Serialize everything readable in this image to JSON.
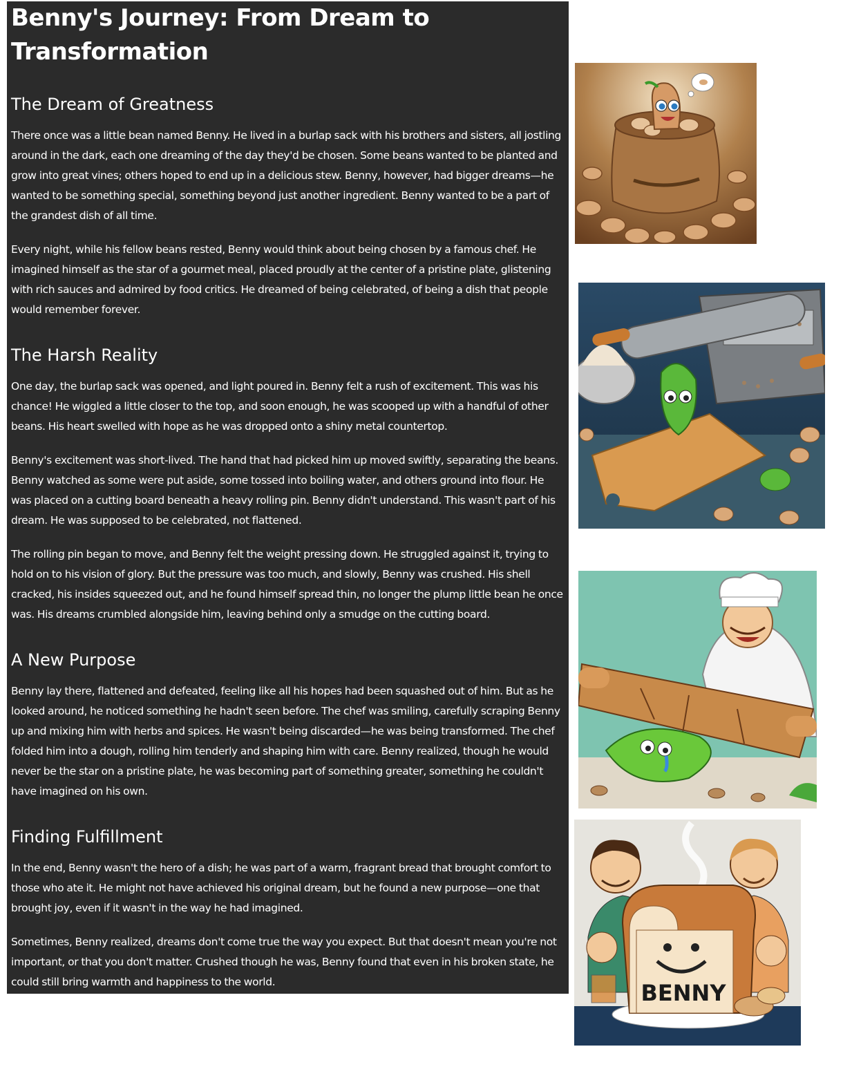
{
  "story": {
    "title": "Benny's Journey: From Dream to Transformation",
    "sections": [
      {
        "heading": "The Dream of Greatness",
        "paragraphs": [
          "There once was a little bean named Benny. He lived in a burlap sack with his brothers and sisters, all jostling around in the dark, each one dreaming of the day they'd be chosen. Some beans wanted to be planted and grow into great vines; others hoped to end up in a delicious stew. Benny, however, had bigger dreams—he wanted to be something special, something beyond just another ingredient. Benny wanted to be a part of the grandest dish of all time.",
          "Every night, while his fellow beans rested, Benny would think about being chosen by a famous chef. He imagined himself as the star of a gourmet meal, placed proudly at the center of a pristine plate, glistening with rich sauces and admired by food critics. He dreamed of being celebrated, of being a dish that people would remember forever."
        ]
      },
      {
        "heading": "The Harsh Reality",
        "paragraphs": [
          "One day, the burlap sack was opened, and light poured in. Benny felt a rush of excitement. This was his chance! He wiggled a little closer to the top, and soon enough, he was scooped up with a handful of other beans. His heart swelled with hope as he was dropped onto a shiny metal countertop.",
          "Benny's excitement was short-lived. The hand that had picked him up moved swiftly, separating the beans. Benny watched as some were put aside, some tossed into boiling water, and others ground into flour. He was placed on a cutting board beneath a heavy rolling pin. Benny didn't understand. This wasn't part of his dream. He was supposed to be celebrated, not flattened.",
          "The rolling pin began to move, and Benny felt the weight pressing down. He struggled against it, trying to hold on to his vision of glory. But the pressure was too much, and slowly, Benny was crushed. His shell cracked, his insides squeezed out, and he found himself spread thin, no longer the plump little bean he once was. His dreams crumbled alongside him, leaving behind only a smudge on the cutting board."
        ]
      },
      {
        "heading": "A New Purpose",
        "paragraphs": [
          "Benny lay there, flattened and defeated, feeling like all his hopes had been squashed out of him. But as he looked around, he noticed something he hadn't seen before. The chef was smiling, carefully scraping Benny up and mixing him with herbs and spices. He wasn't being discarded—he was being transformed. The chef folded him into a dough, rolling him tenderly and shaping him with care. Benny realized, though he would never be the star on a pristine plate, he was becoming part of something greater, something he couldn't have imagined on his own."
        ]
      },
      {
        "heading": "Finding Fulfillment",
        "paragraphs": [
          "In the end, Benny wasn't the hero of a dish; he was part of a warm, fragrant bread that brought comfort to those who ate it. He might not have achieved his original dream, but he found a new purpose—one that brought joy, even if it wasn't in the way he had imagined.",
          "Sometimes, Benny realized, dreams don't come true the way you expect. But that doesn't mean you're not important, or that you don't matter. Crushed though he was, Benny found that even in his broken state, he could still bring warmth and happiness to the world."
        ]
      }
    ]
  },
  "illustrations": {
    "bread_label": "BENNY"
  },
  "colors": {
    "panel_bg": "#2b2b2b",
    "text": "#ffffff",
    "page_bg": "#ffffff"
  }
}
